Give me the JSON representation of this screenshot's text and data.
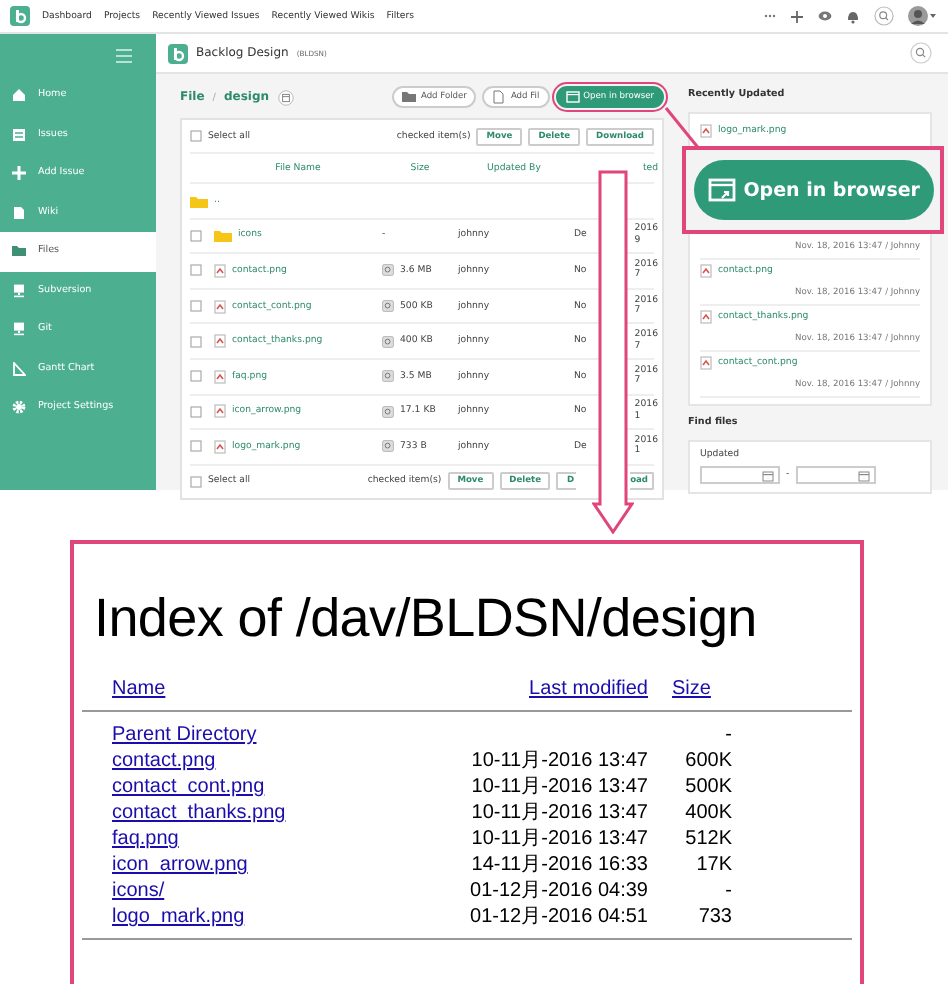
{
  "global_nav": {
    "items": [
      "Dashboard",
      "Projects",
      "Recently Viewed Issues",
      "Recently Viewed Wikis",
      "Filters"
    ]
  },
  "project": {
    "name": "Backlog Design",
    "key": "(BLDSN)"
  },
  "sidebar": {
    "items": [
      {
        "label": "Home",
        "selected": false
      },
      {
        "label": "Issues",
        "selected": false
      },
      {
        "label": "Add Issue",
        "selected": false
      },
      {
        "label": "Wiki",
        "selected": false
      },
      {
        "label": "Files",
        "selected": true
      },
      {
        "label": "Subversion",
        "selected": false
      },
      {
        "label": "Git",
        "selected": false
      },
      {
        "label": "Gantt Chart",
        "selected": false
      },
      {
        "label": "Project Settings",
        "selected": false
      }
    ]
  },
  "breadcrumb": {
    "root": "File",
    "separator": "/",
    "current": "design"
  },
  "toolbar": {
    "buttons": [
      {
        "label": "Add Folder",
        "kind": "folder",
        "highlighted": false
      },
      {
        "label": "Add Fil",
        "kind": "file",
        "highlighted": false
      },
      {
        "label": "Open in browser",
        "kind": "browser",
        "highlighted": true
      }
    ]
  },
  "table": {
    "select_all": "Select all",
    "select_all_checked": false,
    "checked_label": "checked item(s)",
    "actions": [
      "Move",
      "Delete",
      "Download"
    ],
    "columns": [
      "File Name",
      "Size",
      "Updated By",
      "ted"
    ],
    "rows": [
      {
        "kind": "parent",
        "name": ".."
      },
      {
        "kind": "folder",
        "name": "icons",
        "checked": false,
        "size": "-",
        "updated_by": "johnny",
        "date_start": "De",
        "date_end": [
          "2016",
          "9"
        ]
      },
      {
        "kind": "file",
        "name": "contact.png",
        "checked": false,
        "size": "3.6 MB",
        "updated_by": "johnny",
        "date_start": "No",
        "date_end": [
          "2016",
          "7"
        ]
      },
      {
        "kind": "file",
        "name": "contact_cont.png",
        "checked": false,
        "size": "500 KB",
        "updated_by": "johnny",
        "date_start": "No",
        "date_end": [
          "2016",
          "7"
        ]
      },
      {
        "kind": "file",
        "name": "contact_thanks.png",
        "checked": false,
        "size": "400 KB",
        "updated_by": "johnny",
        "date_start": "No",
        "date_end": [
          "2016",
          "7"
        ]
      },
      {
        "kind": "file",
        "name": "faq.png",
        "checked": false,
        "size": "3.5 MB",
        "updated_by": "johnny",
        "date_start": "No",
        "date_end": [
          "2016",
          "7"
        ]
      },
      {
        "kind": "file",
        "name": "icon_arrow.png",
        "checked": false,
        "size": "17.1 KB",
        "updated_by": "johnny",
        "date_start": "No",
        "date_end": [
          "2016",
          "1"
        ]
      },
      {
        "kind": "file",
        "name": "logo_mark.png",
        "checked": false,
        "size": "733 B",
        "updated_by": "johnny",
        "date_start": "De",
        "date_end": [
          "2016",
          "1"
        ]
      }
    ],
    "footer": {
      "select_all": "Select all",
      "select_all_checked": false,
      "checked_label": "checked item(s)",
      "actions": [
        "Move",
        "Delete"
      ],
      "download_start": "D",
      "download_end": "oad"
    }
  },
  "recently_updated": {
    "title": "Recently Updated",
    "items": [
      {
        "name": "logo_mark.png"
      },
      {
        "meta": "Nov. 18, 2016 13:47  /  Johnny"
      },
      {
        "name": "contact.png",
        "meta": "Nov. 18, 2016 13:47  /  Johnny"
      },
      {
        "name": "contact_thanks.png",
        "meta": "Nov. 18, 2016 13:47  /  Johnny"
      },
      {
        "name": "contact_cont.png",
        "meta": "Nov. 18, 2016 13:47  /  Johnny"
      }
    ]
  },
  "find_files": {
    "title": "Find files",
    "label": "Updated",
    "separator": "-"
  },
  "callout": {
    "label": "Open in browser"
  },
  "index_page": {
    "title": "Index of /dav/BLDSN/design",
    "columns": [
      "Name",
      "Last modified",
      "Size"
    ],
    "rows": [
      {
        "name": "Parent Directory",
        "modified": "",
        "size": "-"
      },
      {
        "name": "contact.png",
        "modified": "10-11月-2016 13:47",
        "size": "600K"
      },
      {
        "name": "contact_cont.png",
        "modified": "10-11月-2016 13:47",
        "size": "500K"
      },
      {
        "name": "contact_thanks.png",
        "modified": "10-11月-2016 13:47",
        "size": "400K"
      },
      {
        "name": "faq.png",
        "modified": "10-11月-2016 13:47",
        "size": "512K"
      },
      {
        "name": "icon_arrow.png",
        "modified": "14-11月-2016 16:33",
        "size": "17K"
      },
      {
        "name": "icons/",
        "modified": "01-12月-2016 04:39",
        "size": "-"
      },
      {
        "name": "logo_mark.png",
        "modified": "01-12月-2016 04:51",
        "size": "733"
      }
    ]
  }
}
